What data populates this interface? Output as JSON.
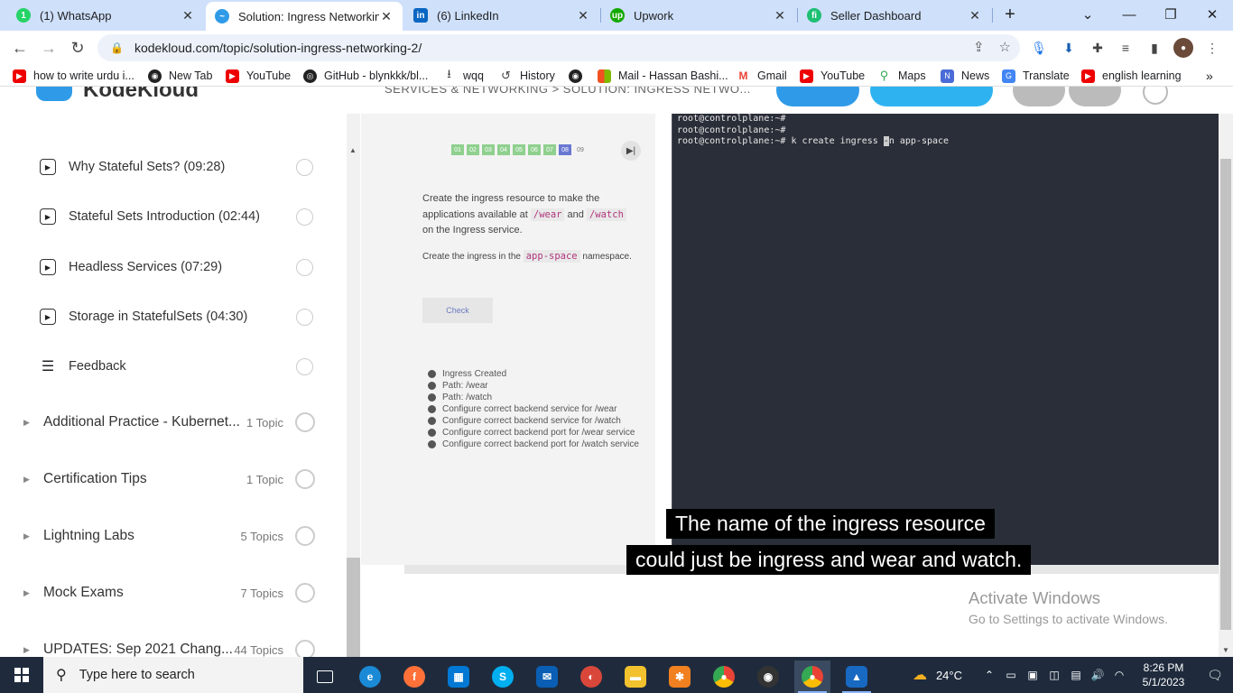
{
  "browser": {
    "tabs": [
      {
        "title": "(1) WhatsApp",
        "icon": "whatsapp-icon",
        "color": "#25d366",
        "glyph": "1"
      },
      {
        "title": "Solution: Ingress Networking",
        "icon": "kodekloud-icon",
        "color": "#2f9be8",
        "glyph": "~",
        "active": true
      },
      {
        "title": "(6) LinkedIn",
        "icon": "linkedin-icon",
        "color": "#0a66c2",
        "glyph": "in"
      },
      {
        "title": "Upwork",
        "icon": "upwork-icon",
        "color": "#14a800",
        "glyph": "up"
      },
      {
        "title": "Seller Dashboard",
        "icon": "fiverr-icon",
        "color": "#1dbf73",
        "glyph": "fi"
      }
    ],
    "new_tab": "+",
    "close": "✕",
    "url": "kodekloud.com/topic/solution-ingress-networking-2/",
    "bookmarks": [
      {
        "label": "how to write urdu i...",
        "icon": "youtube-icon",
        "color": "#e00"
      },
      {
        "label": "New Tab",
        "icon": "globe-icon",
        "color": "#222"
      },
      {
        "label": "YouTube",
        "icon": "youtube-icon",
        "color": "#e00"
      },
      {
        "label": "GitHub - blynkkk/bl...",
        "icon": "github-icon",
        "color": "#222"
      },
      {
        "label": "wqq",
        "icon": "download-icon",
        "color": "#444"
      },
      {
        "label": "History",
        "icon": "history-icon",
        "color": "#444"
      },
      {
        "label": "",
        "icon": "globe-icon",
        "color": "#222"
      },
      {
        "label": "Mail - Hassan Bashi...",
        "icon": "microsoft-icon",
        "color": "#f25022"
      },
      {
        "label": "Gmail",
        "icon": "gmail-icon",
        "color": "#ea4335"
      },
      {
        "label": "YouTube",
        "icon": "youtube-icon",
        "color": "#e00"
      },
      {
        "label": "Maps",
        "icon": "maps-icon",
        "color": "#34a853"
      },
      {
        "label": "News",
        "icon": "news-icon",
        "color": "#4b6bd6"
      },
      {
        "label": "Translate",
        "icon": "translate-icon",
        "color": "#4285f4"
      },
      {
        "label": "english learning",
        "icon": "youtube-icon",
        "color": "#e00"
      }
    ],
    "more": "»"
  },
  "site": {
    "brand": "KodeKloud",
    "breadcrumb": "SERVICES & NETWORKING > SOLUTION: INGRESS NETWO..."
  },
  "sidebar": {
    "lessons": [
      {
        "label": "Why Stateful Sets? (09:28)"
      },
      {
        "label": "Stateful Sets Introduction (02:44)"
      },
      {
        "label": "Headless Services (07:29)"
      },
      {
        "label": "Storage in StatefulSets (04:30)"
      },
      {
        "label": "Feedback",
        "icon": "list-icon"
      }
    ],
    "sections": [
      {
        "label": "Additional Practice - Kubernet...",
        "count": "1 Topic"
      },
      {
        "label": "Certification Tips",
        "count": "1 Topic"
      },
      {
        "label": "Lightning Labs",
        "count": "5 Topics"
      },
      {
        "label": "Mock Exams",
        "count": "7 Topics"
      },
      {
        "label": "UPDATES: Sep 2021 Chang...",
        "count": "44 Topics"
      }
    ]
  },
  "lab": {
    "steps": [
      "01",
      "02",
      "03",
      "04",
      "05",
      "06",
      "07",
      "08",
      "09"
    ],
    "current_step": "08",
    "question_p1_a": "Create the ingress resource to make the applications available at",
    "tok_wear": "/wear",
    "and": "and",
    "tok_watch": "/watch",
    "question_p1_b": "on the Ingress service.",
    "question_p2_a": "Create the ingress in the",
    "tok_ns": "app-space",
    "question_p2_b": "namespace.",
    "check_label": "Check",
    "checklist": [
      "Ingress Created",
      "Path: /wear",
      "Path: /watch",
      "Configure correct backend service for /wear",
      "Configure correct backend service for /watch",
      "Configure correct backend port for /wear service",
      "Configure correct backend port for /watch service"
    ]
  },
  "terminal": {
    "lines": [
      "root@controlplane:~#",
      "root@controlplane:~#"
    ],
    "prompt": "root@controlplane:~# ",
    "cmd_before": "k create ingress ",
    "cmd_cursor": "-",
    "cmd_after": "n app-space"
  },
  "caption": {
    "line1": "The name of the ingress resource",
    "line2": "could just be ingress and wear and watch."
  },
  "activate": {
    "title": "Activate Windows",
    "subtitle": "Go to Settings to activate Windows."
  },
  "taskbar": {
    "search_placeholder": "Type here to search",
    "weather": "24°C",
    "time": "8:26 PM",
    "date": "5/1/2023"
  }
}
